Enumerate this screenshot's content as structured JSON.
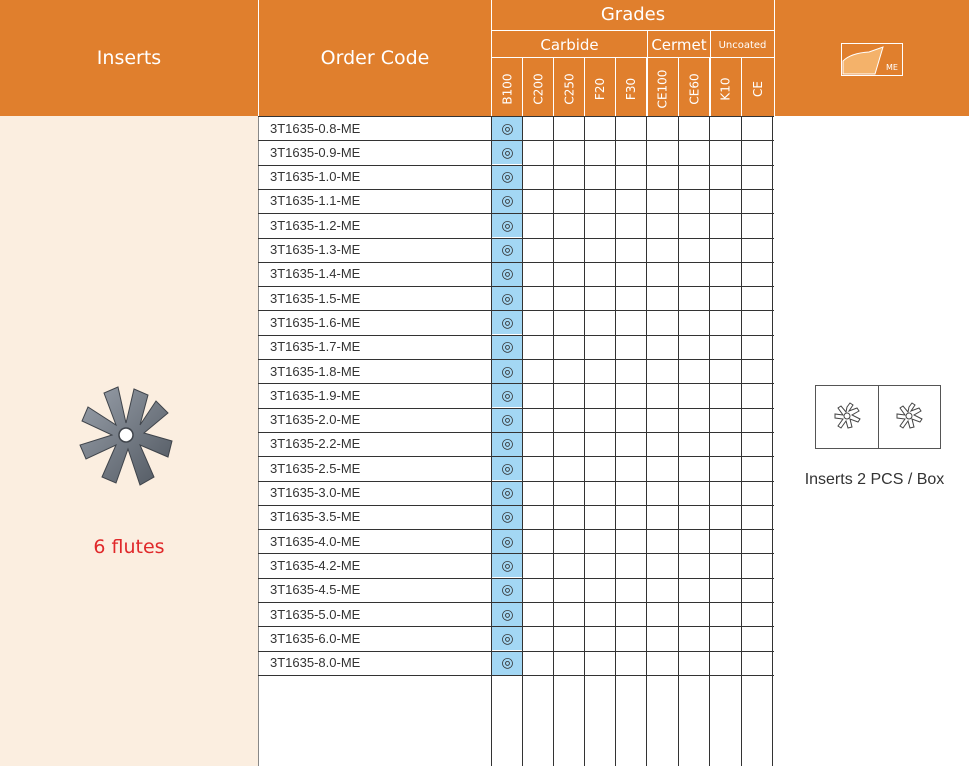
{
  "header": {
    "inserts": "Inserts",
    "order_code": "Order Code",
    "grades": "Grades",
    "carbide": "Carbide",
    "cermet": "Cermet",
    "uncoated": "Uncoated",
    "logo_text": "ME"
  },
  "grades": [
    "B100",
    "C200",
    "C250",
    "F20",
    "F30",
    "CE100",
    "CE60",
    "K10",
    "CE"
  ],
  "mark": "◎",
  "rows": [
    "3T1635-0.8-ME",
    "3T1635-0.9-ME",
    "3T1635-1.0-ME",
    "3T1635-1.1-ME",
    "3T1635-1.2-ME",
    "3T1635-1.3-ME",
    "3T1635-1.4-ME",
    "3T1635-1.5-ME",
    "3T1635-1.6-ME",
    "3T1635-1.7-ME",
    "3T1635-1.8-ME",
    "3T1635-1.9-ME",
    "3T1635-2.0-ME",
    "3T1635-2.2-ME",
    "3T1635-2.5-ME",
    "3T1635-3.0-ME",
    "3T1635-3.5-ME",
    "3T1635-4.0-ME",
    "3T1635-4.2-ME",
    "3T1635-4.5-ME",
    "3T1635-5.0-ME",
    "3T1635-6.0-ME",
    "3T1635-8.0-ME"
  ],
  "insert": {
    "flutes": "6 flutes"
  },
  "packaging": "Inserts 2 PCS / Box",
  "colors": {
    "header": "#e07f2d",
    "left_bg": "#fbeee0",
    "b100_bg": "#a3d7f4",
    "flutes_text": "#e0282a"
  }
}
